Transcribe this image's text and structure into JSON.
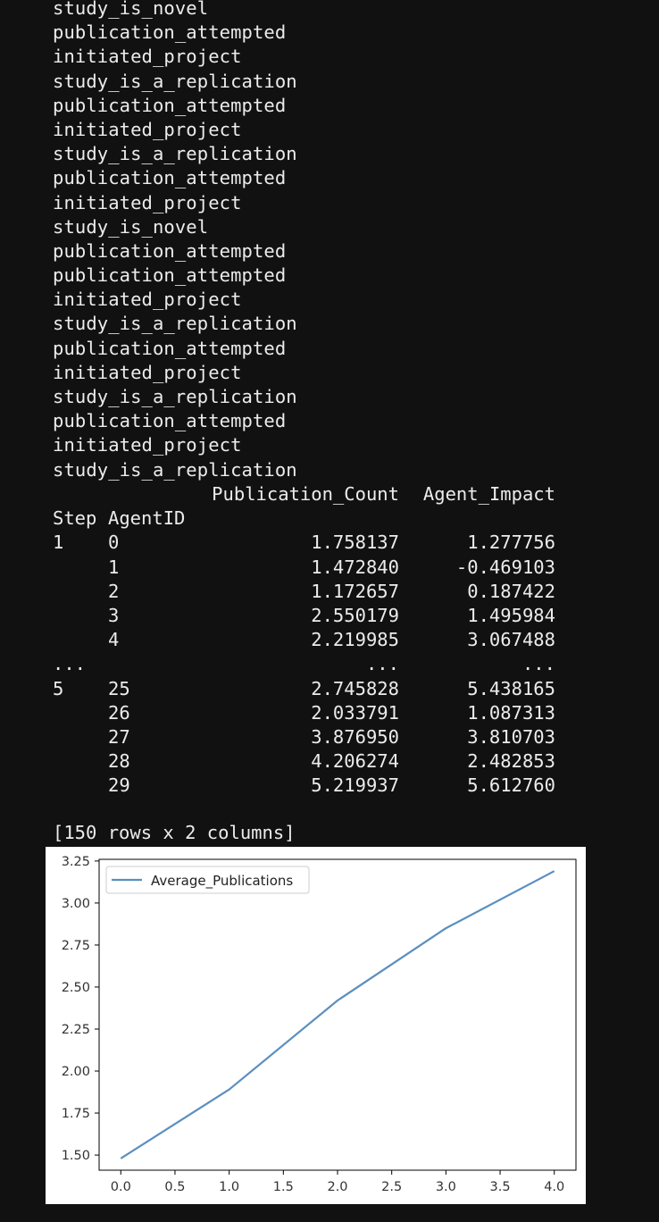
{
  "log_lines": [
    "study_is_novel",
    "publication_attempted",
    "initiated_project",
    "study_is_a_replication",
    "publication_attempted",
    "initiated_project",
    "study_is_a_replication",
    "publication_attempted",
    "initiated_project",
    "study_is_novel",
    "publication_attempted",
    "publication_attempted",
    "initiated_project",
    "study_is_a_replication",
    "publication_attempted",
    "initiated_project",
    "study_is_a_replication",
    "publication_attempted",
    "initiated_project",
    "study_is_a_replication"
  ],
  "dataframe": {
    "columns": [
      "Publication_Count",
      "Agent_Impact"
    ],
    "index_names": [
      "Step",
      "AgentID"
    ],
    "rows": [
      {
        "step": "1",
        "agent": "0",
        "pub": "1.758137",
        "imp": "1.277756"
      },
      {
        "step": "",
        "agent": "1",
        "pub": "1.472840",
        "imp": "-0.469103"
      },
      {
        "step": "",
        "agent": "2",
        "pub": "1.172657",
        "imp": "0.187422"
      },
      {
        "step": "",
        "agent": "3",
        "pub": "2.550179",
        "imp": "1.495984"
      },
      {
        "step": "",
        "agent": "4",
        "pub": "2.219985",
        "imp": "3.067488"
      },
      {
        "step": "...",
        "agent": "",
        "pub": "...",
        "imp": "..."
      },
      {
        "step": "5",
        "agent": "25",
        "pub": "2.745828",
        "imp": "5.438165"
      },
      {
        "step": "",
        "agent": "26",
        "pub": "2.033791",
        "imp": "1.087313"
      },
      {
        "step": "",
        "agent": "27",
        "pub": "3.876950",
        "imp": "3.810703"
      },
      {
        "step": "",
        "agent": "28",
        "pub": "4.206274",
        "imp": "2.482853"
      },
      {
        "step": "",
        "agent": "29",
        "pub": "5.219937",
        "imp": "5.612760"
      }
    ],
    "summary": "[150 rows x 2 columns]"
  },
  "chart_data": {
    "type": "line",
    "title": "",
    "xlabel": "",
    "ylabel": "",
    "x": [
      0.0,
      1.0,
      2.0,
      3.0,
      4.0
    ],
    "series": [
      {
        "name": "Average_Publications",
        "values": [
          1.48,
          1.89,
          2.42,
          2.85,
          3.19
        ],
        "color": "#5b8fbf"
      }
    ],
    "xlim": [
      -0.2,
      4.2
    ],
    "ylim": [
      1.41,
      3.26
    ],
    "xticks": [
      "0.0",
      "0.5",
      "1.0",
      "1.5",
      "2.0",
      "2.5",
      "3.0",
      "3.5",
      "4.0"
    ],
    "yticks": [
      "1.50",
      "1.75",
      "2.00",
      "2.25",
      "2.50",
      "2.75",
      "3.00",
      "3.25"
    ],
    "grid": false,
    "legend": "upper left"
  }
}
